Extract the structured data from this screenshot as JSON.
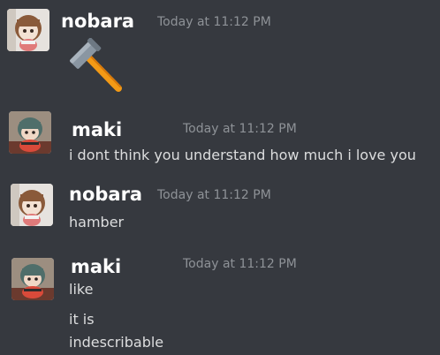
{
  "messages": [
    {
      "author": "nobara",
      "timestamp": "Today at 11:12 PM",
      "avatar_icon": "nobara-plush-avatar",
      "emoji": "hammer-emoji",
      "lines": []
    },
    {
      "author": "maki",
      "timestamp": "Today at 11:12 PM",
      "avatar_icon": "maki-plush-avatar",
      "lines": [
        "i dont think you understand how much i love you"
      ]
    },
    {
      "author": "nobara",
      "timestamp": "Today at 11:12 PM",
      "avatar_icon": "nobara-plush-avatar",
      "lines": [
        "hamber"
      ]
    },
    {
      "author": "maki",
      "timestamp": "Today at 11:12 PM",
      "avatar_icon": "maki-plush-avatar",
      "lines": [
        "like",
        "it is",
        "indescribable"
      ]
    }
  ],
  "colors": {
    "background": "#36393f",
    "username": "#ffffff",
    "timestamp": "#8e9297",
    "message_text": "#dcddde"
  }
}
